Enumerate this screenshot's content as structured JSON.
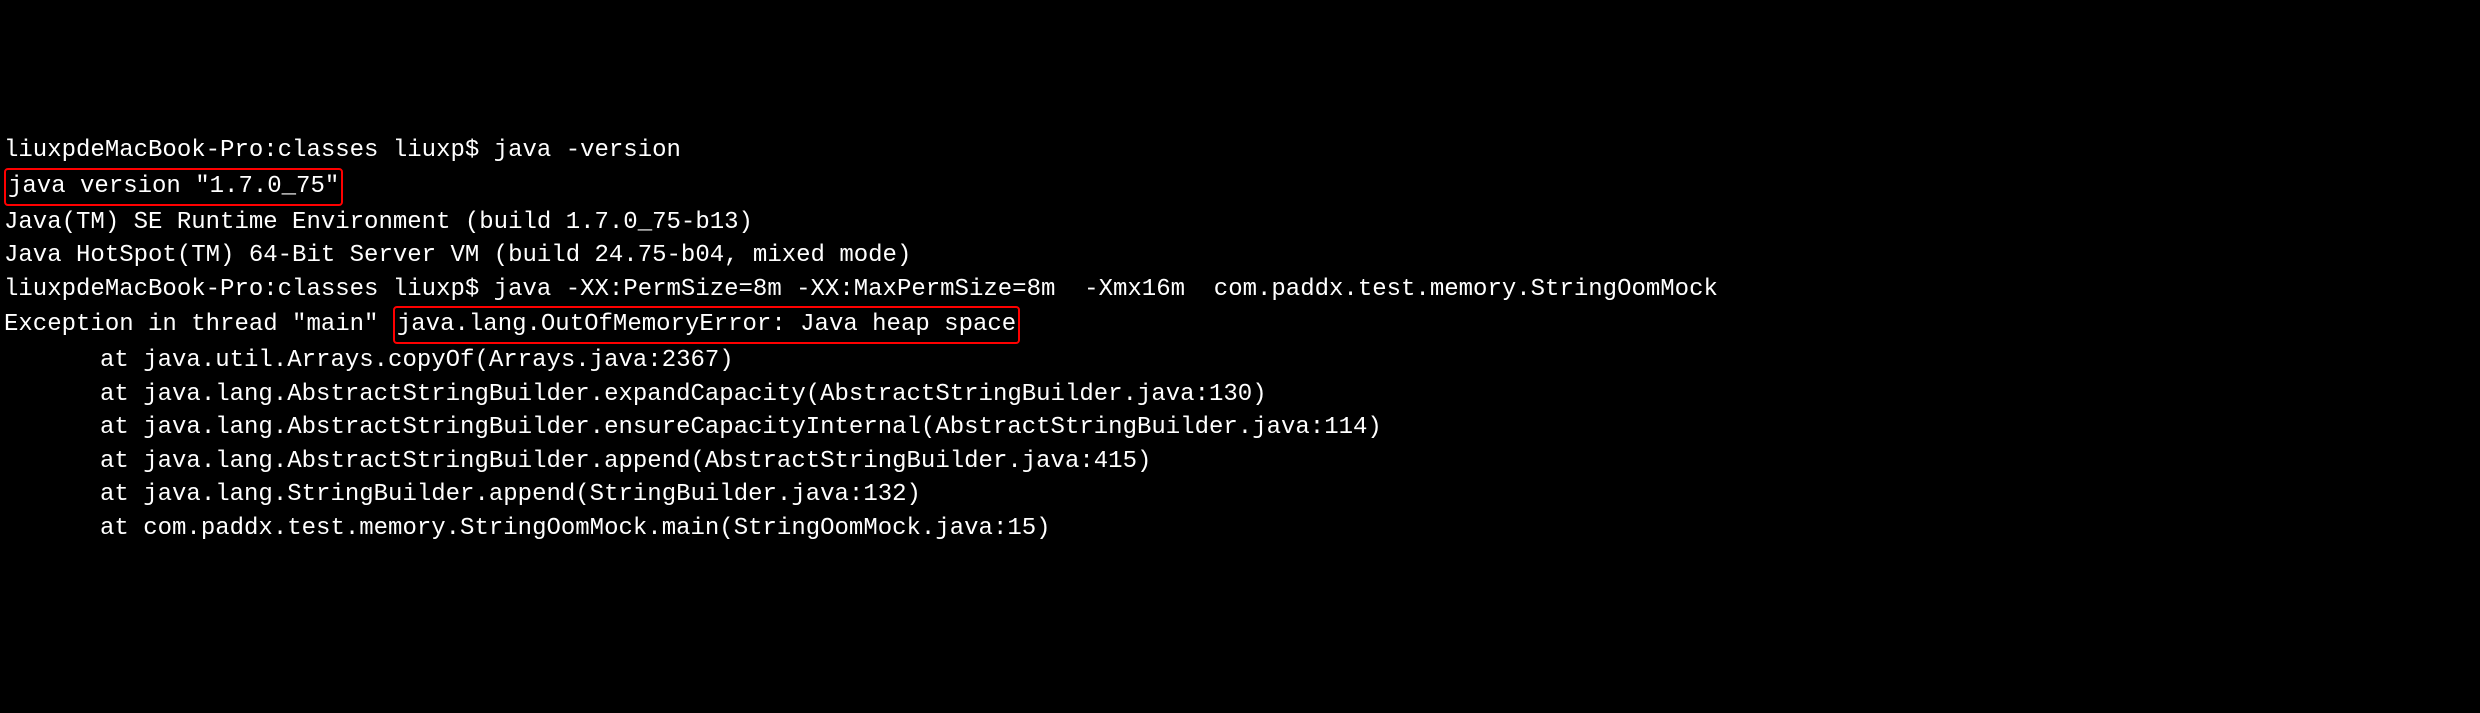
{
  "terminal": {
    "line1_prompt": "liuxpdeMacBook-Pro:classes liuxp$ java -version",
    "line2_highlighted": "java version \"1.7.0_75\"",
    "line3": "Java(TM) SE Runtime Environment (build 1.7.0_75-b13)",
    "line4": "Java HotSpot(TM) 64-Bit Server VM (build 24.75-b04, mixed mode)",
    "line5_prompt": "liuxpdeMacBook-Pro:classes liuxp$ java -XX:PermSize=8m -XX:MaxPermSize=8m  -Xmx16m  com.paddx.test.memory.StringOomMock",
    "line6_prefix": "Exception in thread \"main\" ",
    "line6_highlighted": "java.lang.OutOfMemoryError: Java heap space",
    "stacktrace": [
      "at java.util.Arrays.copyOf(Arrays.java:2367)",
      "at java.lang.AbstractStringBuilder.expandCapacity(AbstractStringBuilder.java:130)",
      "at java.lang.AbstractStringBuilder.ensureCapacityInternal(AbstractStringBuilder.java:114)",
      "at java.lang.AbstractStringBuilder.append(AbstractStringBuilder.java:415)",
      "at java.lang.StringBuilder.append(StringBuilder.java:132)",
      "at com.paddx.test.memory.StringOomMock.main(StringOomMock.java:15)"
    ]
  }
}
